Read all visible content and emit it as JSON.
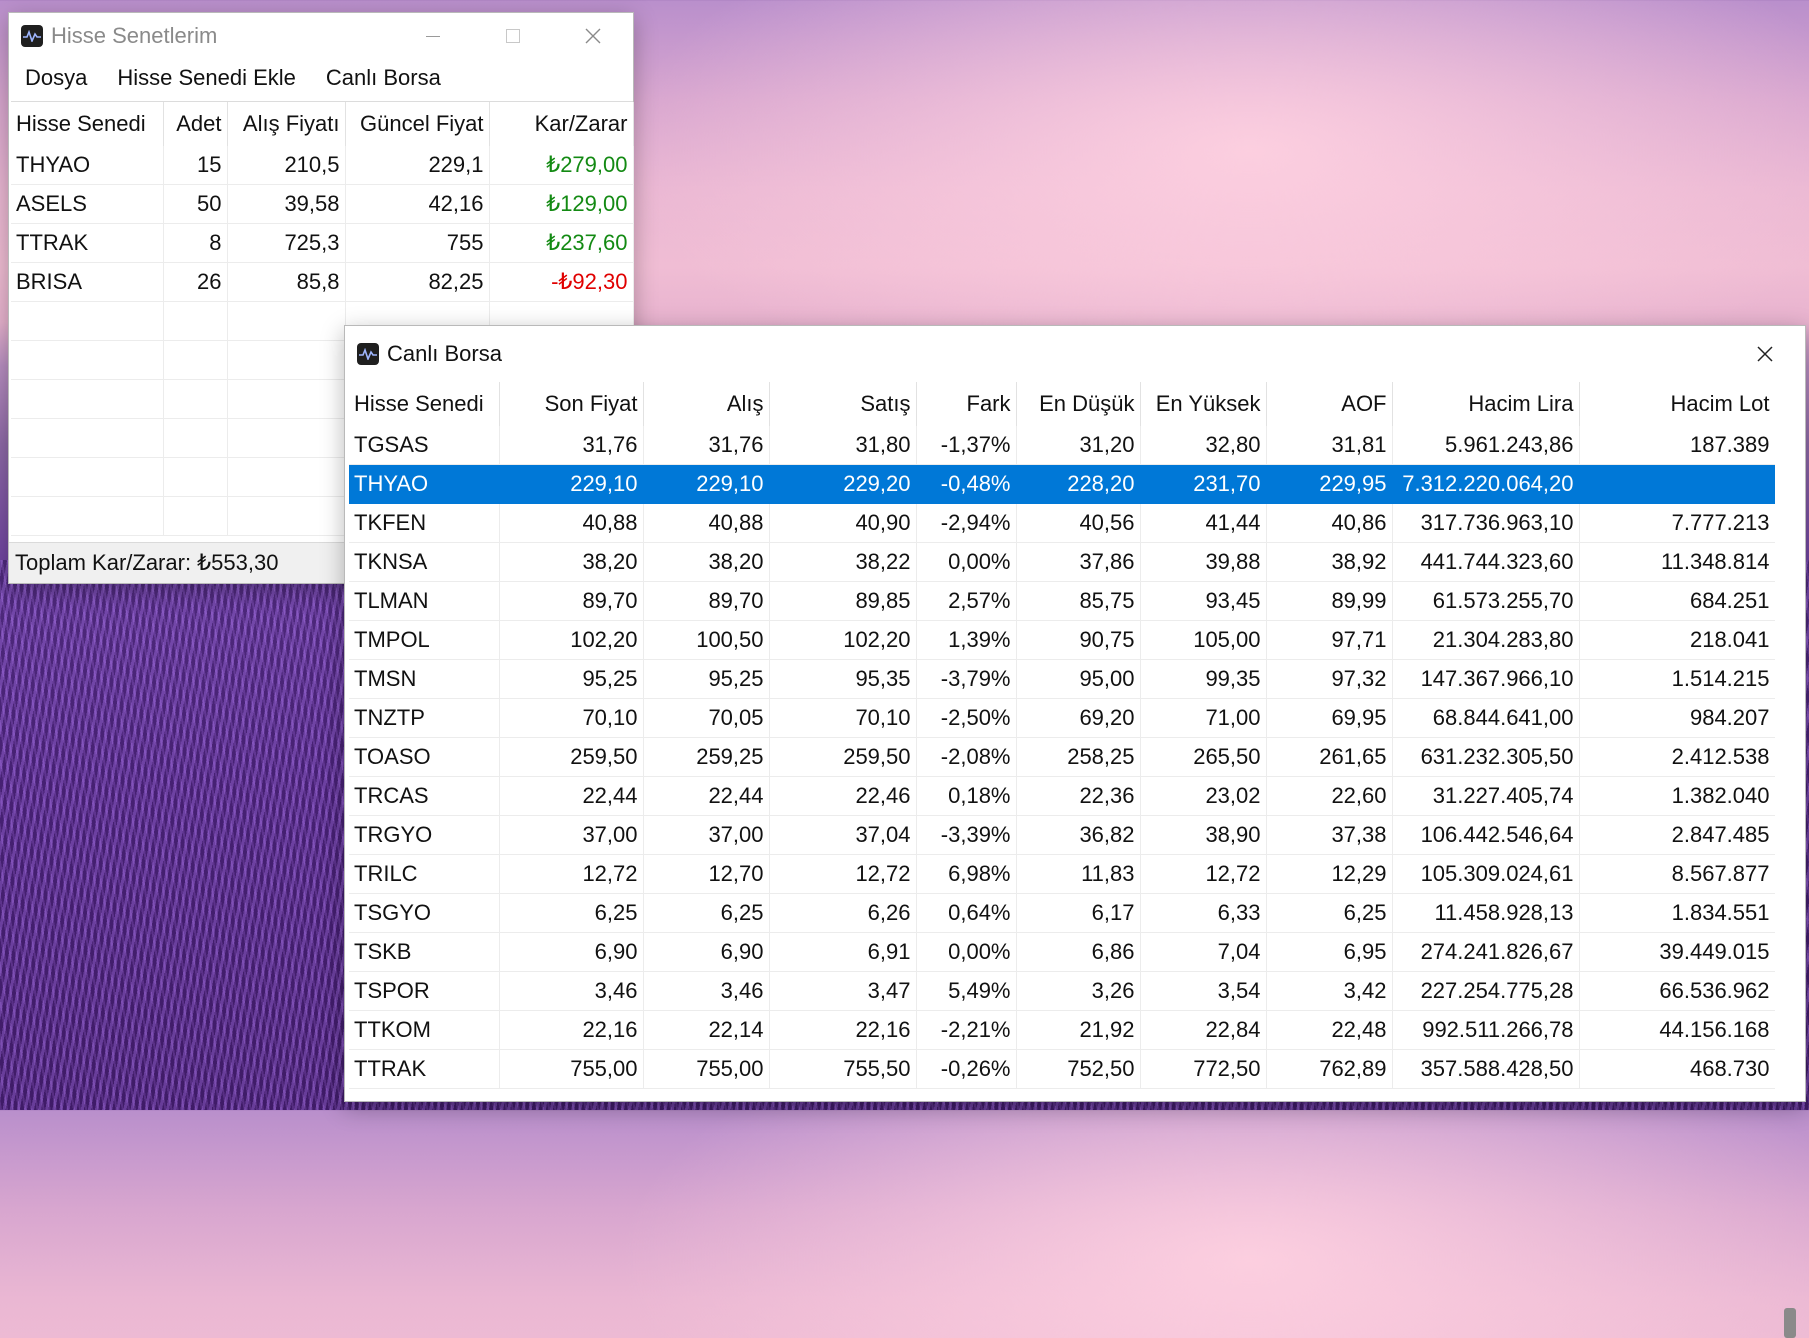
{
  "portfolio_window": {
    "title": "Hisse Senetlerim",
    "menu": [
      "Dosya",
      "Hisse Senedi Ekle",
      "Canlı Borsa"
    ],
    "columns": [
      "Hisse Senedi",
      "Adet",
      "Alış Fiyatı",
      "Güncel Fiyat",
      "Kar/Zarar"
    ],
    "rows": [
      {
        "symbol": "THYAO",
        "qty": "15",
        "buy": "210,5",
        "current": "229,1",
        "pnl": "₺279,00",
        "status": "pos"
      },
      {
        "symbol": "ASELS",
        "qty": "50",
        "buy": "39,58",
        "current": "42,16",
        "pnl": "₺129,00",
        "status": "pos"
      },
      {
        "symbol": "TTRAK",
        "qty": "8",
        "buy": "725,3",
        "current": "755",
        "pnl": "₺237,60",
        "status": "pos"
      },
      {
        "symbol": "BRISA",
        "qty": "26",
        "buy": "85,8",
        "current": "82,25",
        "pnl": "-₺92,30",
        "status": "neg"
      }
    ],
    "total": "Toplam Kar/Zarar: ₺553,30",
    "colors": {
      "positive": "#138a13",
      "negative": "#e00000"
    }
  },
  "live_window": {
    "title": "Canlı Borsa",
    "columns": [
      "Hisse Senedi",
      "Son Fiyat",
      "Alış",
      "Satış",
      "Fark",
      "En Düşük",
      "En Yüksek",
      "AOF",
      "Hacim Lira",
      "Hacim Lot"
    ],
    "selected_index": 1,
    "selection_color": "#0078d7",
    "rows": [
      [
        "TGSAS",
        "31,76",
        "31,76",
        "31,80",
        "-1,37%",
        "31,20",
        "32,80",
        "31,81",
        "5.961.243,86",
        "187.389"
      ],
      [
        "THYAO",
        "229,10",
        "229,10",
        "229,20",
        "-0,48%",
        "228,20",
        "231,70",
        "229,95",
        "7.312.220.064,20",
        ""
      ],
      [
        "TKFEN",
        "40,88",
        "40,88",
        "40,90",
        "-2,94%",
        "40,56",
        "41,44",
        "40,86",
        "317.736.963,10",
        "7.777.213"
      ],
      [
        "TKNSA",
        "38,20",
        "38,20",
        "38,22",
        "0,00%",
        "37,86",
        "39,88",
        "38,92",
        "441.744.323,60",
        "11.348.814"
      ],
      [
        "TLMAN",
        "89,70",
        "89,70",
        "89,85",
        "2,57%",
        "85,75",
        "93,45",
        "89,99",
        "61.573.255,70",
        "684.251"
      ],
      [
        "TMPOL",
        "102,20",
        "100,50",
        "102,20",
        "1,39%",
        "90,75",
        "105,00",
        "97,71",
        "21.304.283,80",
        "218.041"
      ],
      [
        "TMSN",
        "95,25",
        "95,25",
        "95,35",
        "-3,79%",
        "95,00",
        "99,35",
        "97,32",
        "147.367.966,10",
        "1.514.215"
      ],
      [
        "TNZTP",
        "70,10",
        "70,05",
        "70,10",
        "-2,50%",
        "69,20",
        "71,00",
        "69,95",
        "68.844.641,00",
        "984.207"
      ],
      [
        "TOASO",
        "259,50",
        "259,25",
        "259,50",
        "-2,08%",
        "258,25",
        "265,50",
        "261,65",
        "631.232.305,50",
        "2.412.538"
      ],
      [
        "TRCAS",
        "22,44",
        "22,44",
        "22,46",
        "0,18%",
        "22,36",
        "23,02",
        "22,60",
        "31.227.405,74",
        "1.382.040"
      ],
      [
        "TRGYO",
        "37,00",
        "37,00",
        "37,04",
        "-3,39%",
        "36,82",
        "38,90",
        "37,38",
        "106.442.546,64",
        "2.847.485"
      ],
      [
        "TRILC",
        "12,72",
        "12,70",
        "12,72",
        "6,98%",
        "11,83",
        "12,72",
        "12,29",
        "105.309.024,61",
        "8.567.877"
      ],
      [
        "TSGYO",
        "6,25",
        "6,25",
        "6,26",
        "0,64%",
        "6,17",
        "6,33",
        "6,25",
        "11.458.928,13",
        "1.834.551"
      ],
      [
        "TSKB",
        "6,90",
        "6,90",
        "6,91",
        "0,00%",
        "6,86",
        "7,04",
        "6,95",
        "274.241.826,67",
        "39.449.015"
      ],
      [
        "TSPOR",
        "3,46",
        "3,46",
        "3,47",
        "5,49%",
        "3,26",
        "3,54",
        "3,42",
        "227.254.775,28",
        "66.536.962"
      ],
      [
        "TTKOM",
        "22,16",
        "22,14",
        "22,16",
        "-2,21%",
        "21,92",
        "22,84",
        "22,48",
        "992.511.266,78",
        "44.156.168"
      ],
      [
        "TTRAK",
        "755,00",
        "755,00",
        "755,50",
        "-0,26%",
        "752,50",
        "772,50",
        "762,89",
        "357.588.428,50",
        "468.730"
      ]
    ]
  }
}
